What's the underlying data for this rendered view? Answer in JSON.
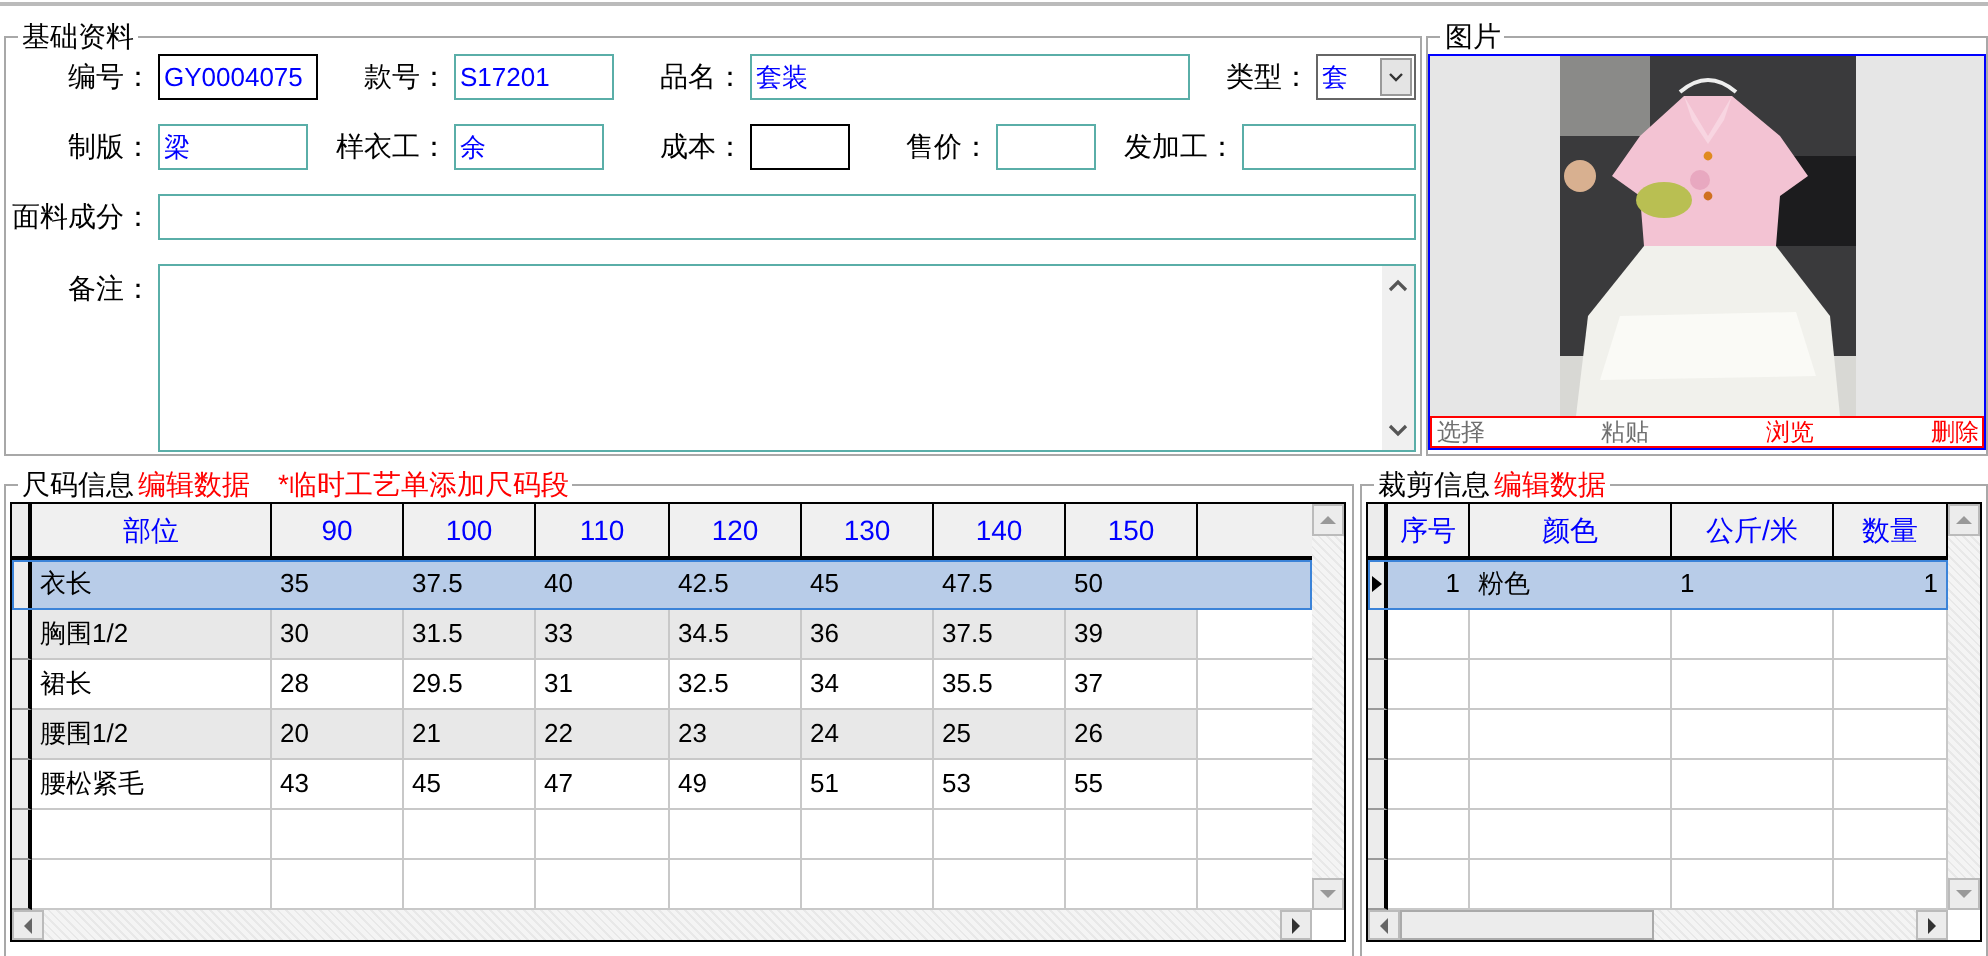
{
  "basic_info": {
    "title": "基础资料",
    "rows": [
      [
        {
          "label": "编号：",
          "value": "GY0004075",
          "kind": "text",
          "emphasized": true
        },
        {
          "label": "款号：",
          "value": "S17201",
          "kind": "text",
          "emphasized": false
        },
        {
          "label": "品名：",
          "value": "套装",
          "kind": "text",
          "emphasized": false
        },
        {
          "label": "类型：",
          "value": "套",
          "kind": "select",
          "emphasized": false
        }
      ],
      [
        {
          "label": "制版：",
          "value": "梁",
          "kind": "text",
          "emphasized": false
        },
        {
          "label": "样衣工：",
          "value": "余",
          "kind": "text",
          "emphasized": false
        },
        {
          "label": "成本：",
          "kind": "text",
          "emphasized": true
        },
        {
          "label": "售价：",
          "kind": "text",
          "emphasized": false
        },
        {
          "label": "发加工：",
          "kind": "text",
          "emphasized": false
        }
      ],
      [
        {
          "label": "面料成分：",
          "kind": "text",
          "emphasized": false
        }
      ],
      [
        {
          "label": "备注：",
          "kind": "textarea",
          "emphasized": false
        }
      ]
    ]
  },
  "picture": {
    "title": "图片",
    "actions": [
      {
        "label": "选择",
        "disabled": true
      },
      {
        "label": "粘贴",
        "disabled": true
      },
      {
        "label": "浏览",
        "disabled": false
      },
      {
        "label": "删除",
        "disabled": false
      }
    ]
  },
  "size_info": {
    "title": "尺码信息",
    "edit_link": "编辑数据",
    "note": "*临时工艺单添加尺码段",
    "columns": [
      "部位",
      "90",
      "100",
      "110",
      "120",
      "130",
      "140",
      "150"
    ],
    "rows": [
      {
        "cells": [
          "衣长",
          "35",
          "37.5",
          "40",
          "42.5",
          "45",
          "47.5",
          "50"
        ],
        "selected": true
      },
      {
        "cells": [
          "胸围1/2",
          "30",
          "31.5",
          "33",
          "34.5",
          "36",
          "37.5",
          "39"
        ],
        "selected": false
      },
      {
        "cells": [
          "裙长",
          "28",
          "29.5",
          "31",
          "32.5",
          "34",
          "35.5",
          "37"
        ],
        "selected": false
      },
      {
        "cells": [
          "腰围1/2",
          "20",
          "21",
          "22",
          "23",
          "24",
          "25",
          "26"
        ],
        "selected": false
      },
      {
        "cells": [
          "腰松紧毛",
          "43",
          "45",
          "47",
          "49",
          "51",
          "53",
          "55"
        ],
        "selected": false
      }
    ]
  },
  "cut_info": {
    "title": "裁剪信息",
    "edit_link": "编辑数据",
    "columns": [
      "序号",
      "颜色",
      "公斤/米",
      "数量"
    ],
    "rows": [
      {
        "cells": [
          "1",
          "粉色",
          "1",
          "1"
        ],
        "selected": true
      }
    ]
  }
}
